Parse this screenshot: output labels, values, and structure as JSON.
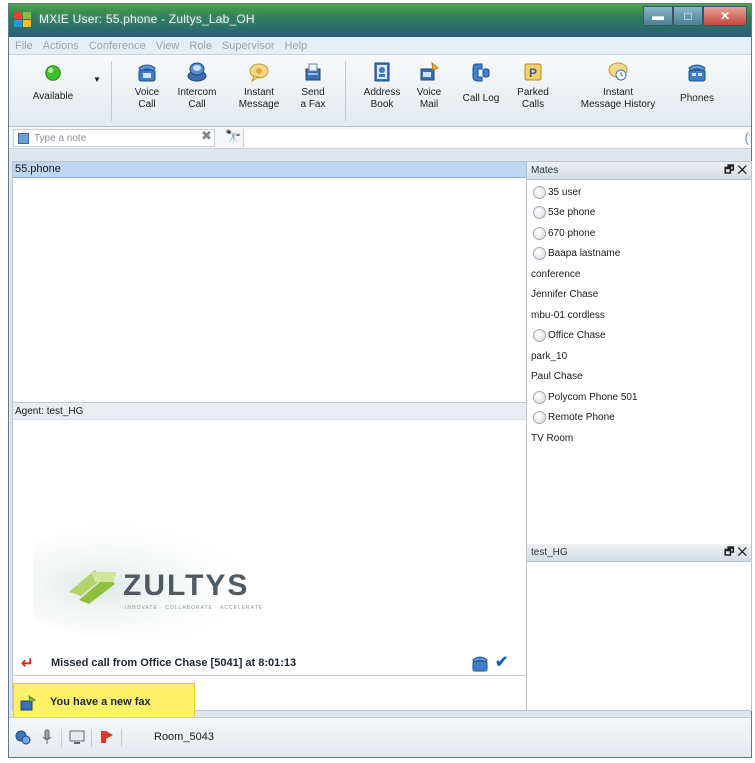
{
  "window": {
    "title": "MXIE User: 55.phone - Zultys_Lab_OH",
    "minimize_glyph": "▬",
    "maximize_glyph": "□",
    "close_glyph": "✕"
  },
  "menu": [
    "File",
    "Actions",
    "Conference",
    "View",
    "Role",
    "Supervisor",
    "Help"
  ],
  "toolbar": {
    "presence": "Available",
    "voice_call": [
      "Voice",
      "Call"
    ],
    "intercom_call": [
      "Intercom",
      "Call"
    ],
    "instant_message": [
      "Instant",
      "Message"
    ],
    "send_fax": [
      "Send",
      "a Fax"
    ],
    "address_book": [
      "Address",
      "Book"
    ],
    "voice_mail": [
      "Voice",
      "Mail"
    ],
    "call_log": "Call Log",
    "parked_calls": [
      "Parked",
      "Calls"
    ],
    "im_history": [
      "Instant",
      "Message History"
    ],
    "phones": "Phones"
  },
  "notebar": {
    "note_placeholder": "Type a note",
    "clear_glyph": "✖",
    "find_glyph": "🔭"
  },
  "main": {
    "user": "55.phone",
    "agent_label": "Agent: test_HG",
    "logo_text": "ZULTYS",
    "logo_tagline": "INNOVATE · COLLABORATE · ACCELERATE",
    "missed_call": "Missed call from Office Chase [5041] at 8:01:13",
    "fax_notice": "You have a new fax"
  },
  "mates": {
    "title": "Mates",
    "buttons": "🗗 ✕",
    "items": [
      {
        "name": "35 user",
        "icon": true
      },
      {
        "name": "53e phone",
        "icon": true
      },
      {
        "name": "670 phone",
        "icon": true
      },
      {
        "name": "Baapa lastname",
        "icon": true
      },
      {
        "name": "conference",
        "icon": false
      },
      {
        "name": "Jennifer Chase",
        "icon": false
      },
      {
        "name": "mbu-01 cordless",
        "icon": false
      },
      {
        "name": "Office Chase",
        "icon": true
      },
      {
        "name": "park_10",
        "icon": false
      },
      {
        "name": "Paul Chase",
        "icon": false
      },
      {
        "name": "Polycom Phone 501",
        "icon": true
      },
      {
        "name": "Remote Phone",
        "icon": true
      },
      {
        "name": "TV Room",
        "icon": false
      }
    ]
  },
  "group_panel": {
    "title": "test_HG",
    "buttons": "🗗 ✕"
  },
  "statusbar": {
    "room": "Room_5043"
  }
}
